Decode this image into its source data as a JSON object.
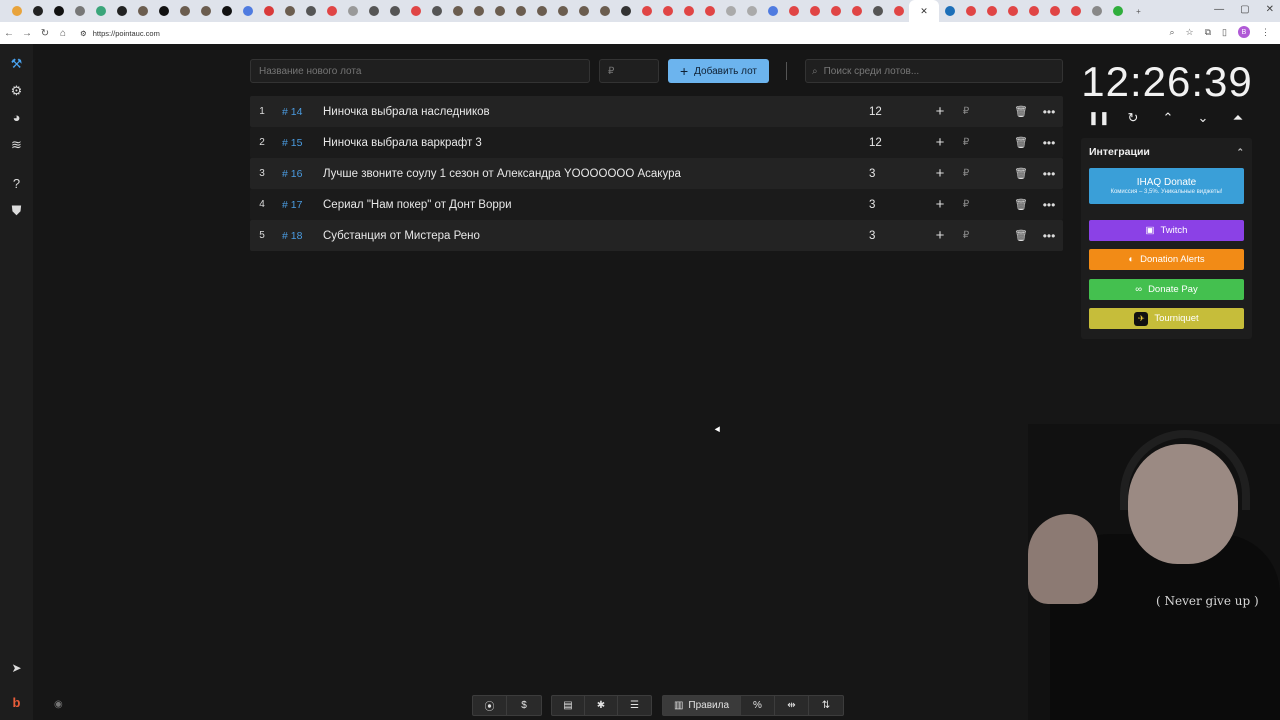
{
  "browser": {
    "url": "https://pointauc.com",
    "profile_initial": "B"
  },
  "toolbar": {
    "new_lot_placeholder": "Название нового лота",
    "amount_placeholder": "₽",
    "add_button_label": "Добавить лот",
    "search_placeholder": "Поиск среди лотов..."
  },
  "lots": [
    {
      "rank": "1",
      "id": "# 14",
      "name": "Ниночка выбрала наследников",
      "amount": "12"
    },
    {
      "rank": "2",
      "id": "# 15",
      "name": "Ниночка выбрала варкрафт 3",
      "amount": "12"
    },
    {
      "rank": "3",
      "id": "# 16",
      "name": "Лучше звоните соулу 1 сезон от Александра YOOOOOOO Асакура",
      "amount": "3"
    },
    {
      "rank": "4",
      "id": "# 17",
      "name": "Сериал \"Нам покер\" от Донт Ворри",
      "amount": "3"
    },
    {
      "rank": "5",
      "id": "# 18",
      "name": "Субстанция от Мистера Рено",
      "amount": "3"
    }
  ],
  "timer": {
    "value": "12:26:39"
  },
  "integrations": {
    "title": "Интеграции",
    "ihaq_title": "IHAQ Donate",
    "ihaq_subtitle": "Комиссия – 3,5%. Уникальные виджеты!",
    "twitch": "Twitch",
    "donation_alerts": "Donation Alerts",
    "donate_pay": "Donate Pay",
    "tourniquet": "Tourniquet"
  },
  "webcam": {
    "shirt_text": "( Never give up )"
  },
  "bottom_toolbar": {
    "rules_label": "Правила",
    "percent_label": "%"
  },
  "colors": {
    "accent": "#6cb4ee",
    "id_link": "#4a9be0",
    "twitch": "#8b41e6",
    "donation_alerts": "#f28b16",
    "donate_pay": "#44c04f",
    "tourniquet": "#c6bd3a",
    "ihaq": "#3a9fd8"
  }
}
